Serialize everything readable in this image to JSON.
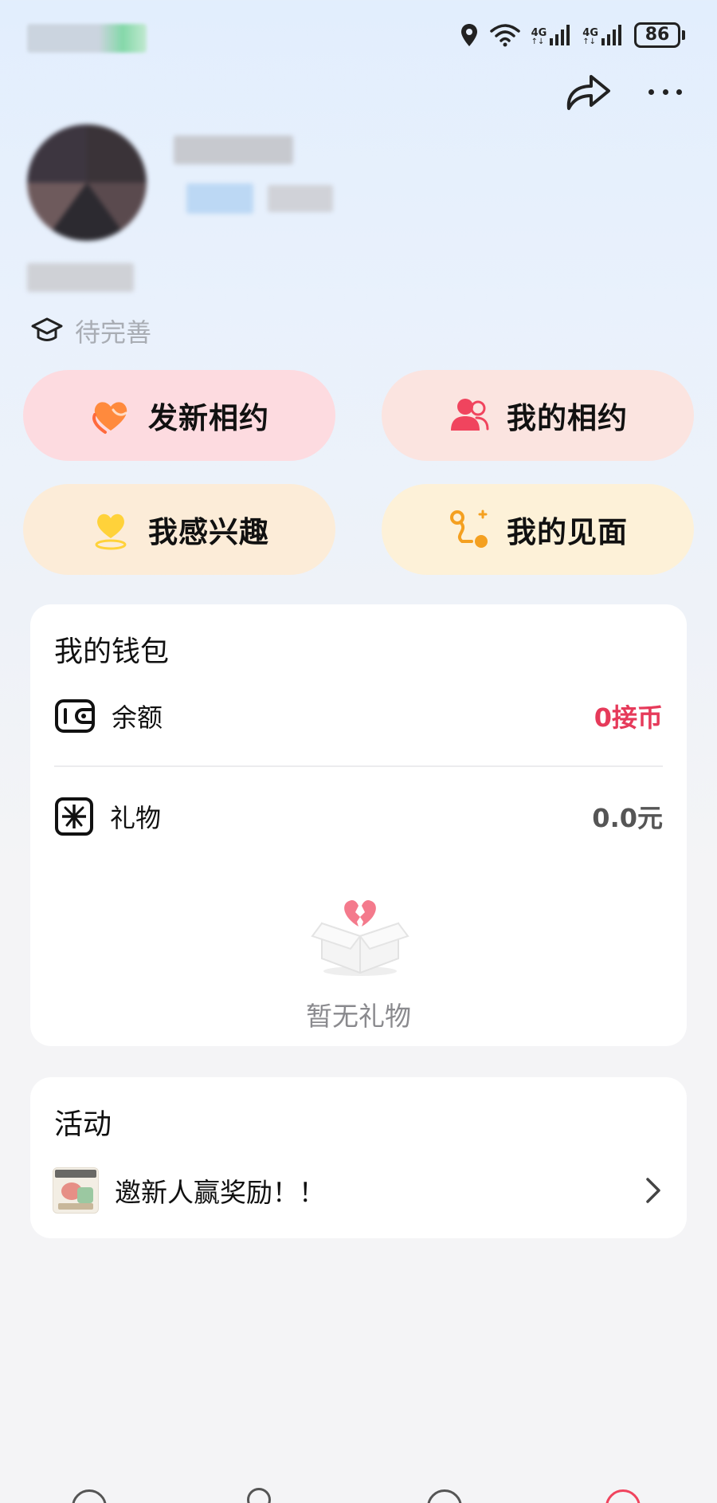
{
  "status_bar": {
    "battery": "86",
    "net1": "4G",
    "net2": "4G",
    "icons": [
      "location-icon",
      "wifi-icon",
      "signal-icon",
      "signal-icon",
      "battery-icon"
    ]
  },
  "header": {
    "actions": [
      "share-icon",
      "more-icon"
    ]
  },
  "profile": {
    "education_label": "待完善"
  },
  "quick_actions": [
    {
      "label": "发新相约",
      "icon": "heart-hand-icon",
      "bg": "#fddbe0"
    },
    {
      "label": "我的相约",
      "icon": "people-icon",
      "bg": "#fbe4e0"
    },
    {
      "label": "我感兴趣",
      "icon": "heart-pin-icon",
      "bg": "#fcecd8"
    },
    {
      "label": "我的见面",
      "icon": "route-icon",
      "bg": "#fdf1d8"
    }
  ],
  "wallet": {
    "title": "我的钱包",
    "balance_label": "余额",
    "balance_value": "0接币",
    "balance_color": "#e63a5a",
    "gift_label": "礼物",
    "gift_value": "0.0元",
    "empty_text": "暂无礼物"
  },
  "activity": {
    "title": "活动",
    "item_text": "邀新人赢奖励！！"
  }
}
